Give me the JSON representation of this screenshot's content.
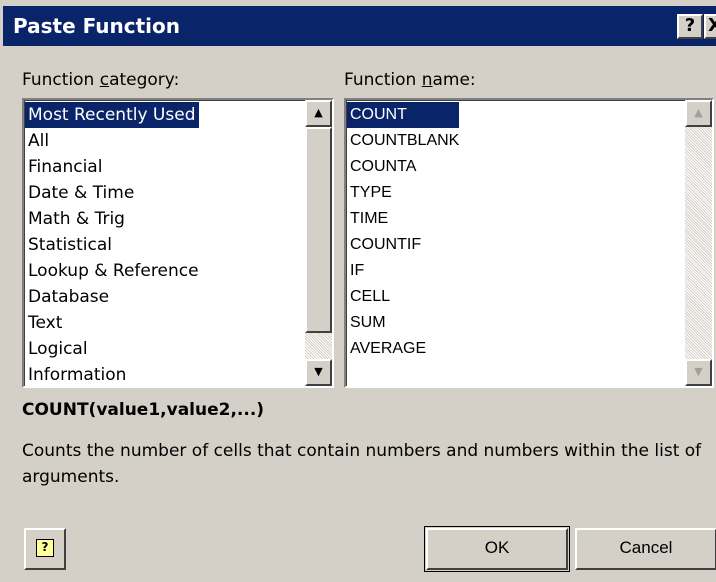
{
  "window": {
    "title": "Paste Function",
    "help_glyph": "?",
    "close_glyph": "X"
  },
  "category_panel": {
    "label_prefix": "Function ",
    "label_mnemonic": "c",
    "label_suffix": "ategory:",
    "selected": "Most Recently Used",
    "items": [
      "Most Recently Used",
      "All",
      "Financial",
      "Date & Time",
      "Math & Trig",
      "Statistical",
      "Lookup & Reference",
      "Database",
      "Text",
      "Logical",
      "Information"
    ]
  },
  "function_panel": {
    "label_prefix": "Function ",
    "label_mnemonic": "n",
    "label_suffix": "ame:",
    "selected": "COUNT",
    "items": [
      "COUNT",
      "COUNTBLANK",
      "COUNTA",
      "TYPE",
      "TIME",
      "COUNTIF",
      "IF",
      "CELL",
      "SUM",
      "AVERAGE"
    ]
  },
  "syntax": "COUNT(value1,value2,...)",
  "description": "Counts the number of cells that contain numbers and numbers within the list of arguments.",
  "buttons": {
    "ok": "OK",
    "cancel": "Cancel",
    "help_glyph": "?"
  },
  "colors": {
    "title_bar": "#0a246a",
    "selection": "#0a246a",
    "face": "#d4d0c8"
  },
  "icons": {
    "scroll_up": "triangle-up",
    "scroll_down": "triangle-down",
    "help": "help-question-icon"
  }
}
